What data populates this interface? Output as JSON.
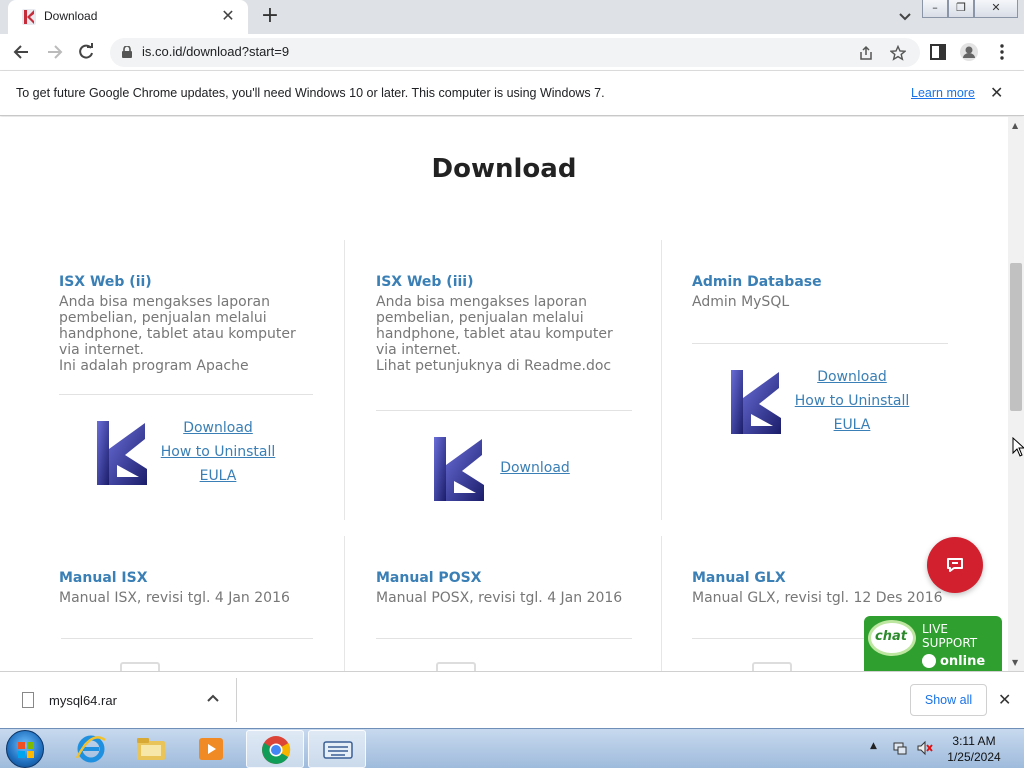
{
  "browser": {
    "tab_title": "Download",
    "url": "is.co.id/download?start=9",
    "info_message": "To get future Google Chrome updates, you'll need Windows 10 or later. This computer is using Windows 7.",
    "learn_more": "Learn more"
  },
  "page": {
    "title": "Download",
    "cards": [
      {
        "title": "ISX Web (ii)",
        "desc": [
          "Anda bisa mengakses laporan pembelian, penjualan melalui handphone, tablet atau komputer via internet.",
          "Ini adalah program Apache"
        ],
        "links": [
          "Download",
          "How to Uninstall",
          "EULA"
        ]
      },
      {
        "title": "ISX Web (iii)",
        "desc": [
          "Anda bisa mengakses laporan pembelian, penjualan melalui handphone, tablet atau komputer via internet.",
          "Lihat petunjuknya di Readme.doc"
        ],
        "links": [
          "Download"
        ]
      },
      {
        "title": "Admin Database",
        "desc": [
          "Admin MySQL"
        ],
        "links": [
          "Download",
          "How to Uninstall",
          "EULA"
        ]
      },
      {
        "title": "Manual ISX",
        "desc": [
          "Manual ISX, revisi tgl. 4 Jan 2016"
        ]
      },
      {
        "title": "Manual POSX",
        "desc": [
          "Manual POSX, revisi tgl. 4 Jan 2016"
        ]
      },
      {
        "title": "Manual GLX",
        "desc": [
          "Manual GLX, revisi tgl. 12 Des 2016"
        ]
      }
    ],
    "live_support": {
      "bubble": "chat",
      "line1": "LIVE",
      "line2": "SUPPORT",
      "status": "online"
    }
  },
  "download_shelf": {
    "file_name": "mysql64.rar",
    "show_all": "Show all"
  },
  "taskbar": {
    "time": "3:11 AM",
    "date": "1/25/2024"
  },
  "colors": {
    "link": "#3a7fb5",
    "chat_button": "#d2202f",
    "live_support": "#2fa030"
  }
}
